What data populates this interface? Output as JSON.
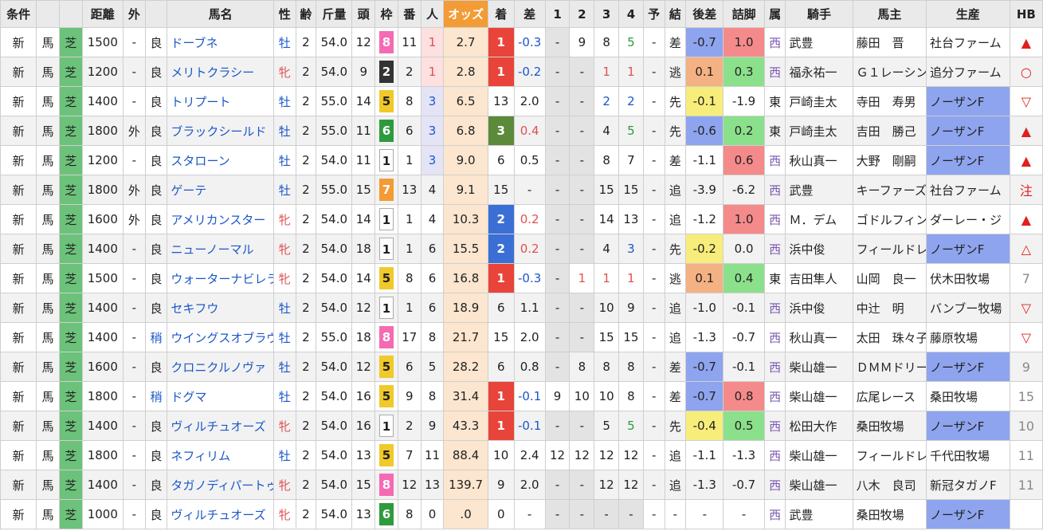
{
  "headers": [
    "条件",
    "",
    "",
    "距離",
    "外",
    "",
    "馬名",
    "性",
    "齢",
    "斤量",
    "頭",
    "枠",
    "番",
    "人",
    "オッズ",
    "着",
    "差",
    "1",
    "2",
    "3",
    "4",
    "予",
    "結",
    "後差",
    "詰脚",
    "属",
    "騎手",
    "馬主",
    "生産",
    "HB"
  ],
  "rows": [
    {
      "c": "新",
      "t": "馬",
      "s": "芝",
      "d": "1500",
      "out": "-",
      "g": "良",
      "name": "ドーブネ",
      "sex": "牡",
      "age": "2",
      "w": "54.0",
      "n": "12",
      "waku": "8",
      "ban": "11",
      "pop": "1",
      "odds": "2.7",
      "fin": "1",
      "diff": "-0.3",
      "p1": "-",
      "p2": "9",
      "p3": "8",
      "p4": "5",
      "yo": "-",
      "res": "差",
      "ago": "-0.7",
      "agoc": "blue",
      "tsu": "1.0",
      "tsuc": "red",
      "bel": "西",
      "jk": "武豊",
      "own": "藤田　晋",
      "prod": "社台ファーム",
      "prodc": "",
      "hb": "▲",
      "hbc": "hbr"
    },
    {
      "c": "新",
      "t": "馬",
      "s": "芝",
      "d": "1200",
      "out": "-",
      "g": "良",
      "name": "メリトクラシー",
      "sex": "牝",
      "age": "2",
      "w": "54.0",
      "n": "9",
      "waku": "2",
      "ban": "2",
      "pop": "1",
      "odds": "2.8",
      "fin": "1",
      "diff": "-0.2",
      "p1": "-",
      "p2": "-",
      "p3": "1",
      "p4": "1",
      "yo": "-",
      "res": "逃",
      "ago": "0.1",
      "agoc": "orange",
      "tsu": "0.3",
      "tsuc": "green",
      "bel": "西",
      "jk": "福永祐一",
      "own": "Ｇ１レーシン",
      "prod": "追分ファーム",
      "prodc": "",
      "hb": "○",
      "hbc": "hbr"
    },
    {
      "c": "新",
      "t": "馬",
      "s": "芝",
      "d": "1400",
      "out": "-",
      "g": "良",
      "name": "トリプート",
      "sex": "牡",
      "age": "2",
      "w": "55.0",
      "n": "14",
      "waku": "5",
      "ban": "8",
      "pop": "3",
      "odds": "6.5",
      "fin": "13",
      "diff": "2.0",
      "p1": "-",
      "p2": "-",
      "p3": "2",
      "p4": "2",
      "yo": "-",
      "res": "先",
      "ago": "-0.1",
      "agoc": "yellow",
      "tsu": "-1.9",
      "tsuc": "",
      "bel": "東",
      "jk": "戸崎圭太",
      "own": "寺田　寿男",
      "prod": "ノーザンF",
      "prodc": "pf",
      "hb": "▽",
      "hbc": "hbr"
    },
    {
      "c": "新",
      "t": "馬",
      "s": "芝",
      "d": "1800",
      "out": "外",
      "g": "良",
      "name": "ブラックシールド",
      "sex": "牡",
      "age": "2",
      "w": "55.0",
      "n": "11",
      "waku": "6",
      "ban": "6",
      "pop": "3",
      "odds": "6.8",
      "fin": "3",
      "diff": "0.4",
      "p1": "-",
      "p2": "-",
      "p3": "4",
      "p4": "5",
      "yo": "-",
      "res": "先",
      "ago": "-0.6",
      "agoc": "blue",
      "tsu": "0.2",
      "tsuc": "green",
      "bel": "東",
      "jk": "戸崎圭太",
      "own": "吉田　勝己",
      "prod": "ノーザンF",
      "prodc": "pf",
      "hb": "▲",
      "hbc": "hbr"
    },
    {
      "c": "新",
      "t": "馬",
      "s": "芝",
      "d": "1200",
      "out": "-",
      "g": "良",
      "name": "スタローン",
      "sex": "牡",
      "age": "2",
      "w": "54.0",
      "n": "11",
      "waku": "1",
      "ban": "1",
      "pop": "3",
      "odds": "9.0",
      "fin": "6",
      "diff": "0.5",
      "p1": "-",
      "p2": "-",
      "p3": "8",
      "p4": "7",
      "yo": "-",
      "res": "差",
      "ago": "-1.1",
      "agoc": "",
      "tsu": "0.6",
      "tsuc": "red",
      "bel": "西",
      "jk": "秋山真一",
      "own": "大野　剛嗣",
      "prod": "ノーザンF",
      "prodc": "pf",
      "hb": "▲",
      "hbc": "hbr"
    },
    {
      "c": "新",
      "t": "馬",
      "s": "芝",
      "d": "1800",
      "out": "外",
      "g": "良",
      "name": "ゲーテ",
      "sex": "牡",
      "age": "2",
      "w": "55.0",
      "n": "15",
      "waku": "7",
      "ban": "13",
      "pop": "4",
      "odds": "9.1",
      "fin": "15",
      "diff": "-",
      "p1": "-",
      "p2": "-",
      "p3": "15",
      "p4": "15",
      "yo": "-",
      "res": "追",
      "ago": "-3.9",
      "agoc": "",
      "tsu": "-6.2",
      "tsuc": "",
      "bel": "西",
      "jk": "武豊",
      "own": "キーファーズ",
      "prod": "社台ファーム",
      "prodc": "",
      "hb": "注",
      "hbc": "hbr"
    },
    {
      "c": "新",
      "t": "馬",
      "s": "芝",
      "d": "1600",
      "out": "外",
      "g": "良",
      "name": "アメリカンスター",
      "sex": "牝",
      "age": "2",
      "w": "54.0",
      "n": "14",
      "waku": "1",
      "ban": "1",
      "pop": "4",
      "odds": "10.3",
      "fin": "2",
      "diff": "0.2",
      "p1": "-",
      "p2": "-",
      "p3": "14",
      "p4": "13",
      "yo": "-",
      "res": "追",
      "ago": "-1.2",
      "agoc": "",
      "tsu": "1.0",
      "tsuc": "red",
      "bel": "西",
      "jk": "Ｍ．デム",
      "own": "ゴドルフィン",
      "prod": "ダーレー・ジ",
      "prodc": "",
      "hb": "▲",
      "hbc": "hbr"
    },
    {
      "c": "新",
      "t": "馬",
      "s": "芝",
      "d": "1400",
      "out": "-",
      "g": "良",
      "name": "ニューノーマル",
      "sex": "牝",
      "age": "2",
      "w": "54.0",
      "n": "18",
      "waku": "1",
      "ban": "1",
      "pop": "6",
      "odds": "15.5",
      "fin": "2",
      "diff": "0.2",
      "p1": "-",
      "p2": "-",
      "p3": "4",
      "p4": "3",
      "yo": "-",
      "res": "先",
      "ago": "-0.2",
      "agoc": "yellow",
      "tsu": "0.0",
      "tsuc": "",
      "bel": "西",
      "jk": "浜中俊",
      "own": "フィールドレ",
      "prod": "ノーザンF",
      "prodc": "pf",
      "hb": "△",
      "hbc": "hbr"
    },
    {
      "c": "新",
      "t": "馬",
      "s": "芝",
      "d": "1500",
      "out": "-",
      "g": "良",
      "name": "ウォーターナビレラ",
      "sex": "牝",
      "age": "2",
      "w": "54.0",
      "n": "14",
      "waku": "5",
      "ban": "8",
      "pop": "6",
      "odds": "16.8",
      "fin": "1",
      "diff": "-0.3",
      "p1": "-",
      "p2": "1",
      "p3": "1",
      "p4": "1",
      "yo": "-",
      "res": "逃",
      "ago": "0.1",
      "agoc": "orange",
      "tsu": "0.4",
      "tsuc": "green",
      "bel": "東",
      "jk": "吉田隼人",
      "own": "山岡　良一",
      "prod": "伏木田牧場",
      "prodc": "",
      "hb": "7",
      "hbc": "hbn"
    },
    {
      "c": "新",
      "t": "馬",
      "s": "芝",
      "d": "1400",
      "out": "-",
      "g": "良",
      "name": "セキフウ",
      "sex": "牡",
      "age": "2",
      "w": "54.0",
      "n": "12",
      "waku": "1",
      "ban": "1",
      "pop": "6",
      "odds": "18.9",
      "fin": "6",
      "diff": "1.1",
      "p1": "-",
      "p2": "-",
      "p3": "10",
      "p4": "9",
      "yo": "-",
      "res": "追",
      "ago": "-1.0",
      "agoc": "",
      "tsu": "-0.1",
      "tsuc": "",
      "bel": "西",
      "jk": "浜中俊",
      "own": "中辻　明",
      "prod": "バンブー牧場",
      "prodc": "",
      "hb": "▽",
      "hbc": "hbr"
    },
    {
      "c": "新",
      "t": "馬",
      "s": "芝",
      "d": "1400",
      "out": "-",
      "g": "稍",
      "name": "ウイングスオブラヴ",
      "sex": "牡",
      "age": "2",
      "w": "55.0",
      "n": "18",
      "waku": "8",
      "ban": "17",
      "pop": "8",
      "odds": "21.7",
      "fin": "15",
      "diff": "2.0",
      "p1": "-",
      "p2": "-",
      "p3": "15",
      "p4": "15",
      "yo": "-",
      "res": "追",
      "ago": "-1.3",
      "agoc": "",
      "tsu": "-0.7",
      "tsuc": "",
      "bel": "西",
      "jk": "秋山真一",
      "own": "太田　珠々子",
      "prod": "藤原牧場",
      "prodc": "",
      "hb": "▽",
      "hbc": "hbr"
    },
    {
      "c": "新",
      "t": "馬",
      "s": "芝",
      "d": "1600",
      "out": "-",
      "g": "良",
      "name": "クロニクルノヴァ",
      "sex": "牡",
      "age": "2",
      "w": "54.0",
      "n": "12",
      "waku": "5",
      "ban": "6",
      "pop": "5",
      "odds": "28.2",
      "fin": "6",
      "diff": "0.8",
      "p1": "-",
      "p2": "8",
      "p3": "8",
      "p4": "8",
      "yo": "-",
      "res": "差",
      "ago": "-0.7",
      "agoc": "blue",
      "tsu": "-0.1",
      "tsuc": "",
      "bel": "西",
      "jk": "柴山雄一",
      "own": "ＤＭＭドリー",
      "prod": "ノーザンF",
      "prodc": "pf",
      "hb": "9",
      "hbc": "hbn"
    },
    {
      "c": "新",
      "t": "馬",
      "s": "芝",
      "d": "1800",
      "out": "-",
      "g": "稍",
      "name": "ドグマ",
      "sex": "牡",
      "age": "2",
      "w": "54.0",
      "n": "16",
      "waku": "5",
      "ban": "9",
      "pop": "8",
      "odds": "31.4",
      "fin": "1",
      "diff": "-0.1",
      "p1": "9",
      "p2": "10",
      "p3": "10",
      "p4": "8",
      "yo": "-",
      "res": "差",
      "ago": "-0.7",
      "agoc": "blue",
      "tsu": "0.8",
      "tsuc": "red",
      "bel": "西",
      "jk": "柴山雄一",
      "own": "広尾レース",
      "prod": "桑田牧場",
      "prodc": "",
      "hb": "15",
      "hbc": "hbn"
    },
    {
      "c": "新",
      "t": "馬",
      "s": "芝",
      "d": "1400",
      "out": "-",
      "g": "良",
      "name": "ヴィルチュオーズ",
      "sex": "牝",
      "age": "2",
      "w": "54.0",
      "n": "16",
      "waku": "1",
      "ban": "2",
      "pop": "9",
      "odds": "43.3",
      "fin": "1",
      "diff": "-0.1",
      "p1": "-",
      "p2": "-",
      "p3": "5",
      "p4": "5",
      "yo": "-",
      "res": "先",
      "ago": "-0.4",
      "agoc": "yellow",
      "tsu": "0.5",
      "tsuc": "green",
      "bel": "西",
      "jk": "松田大作",
      "own": "桑田牧場",
      "prod": "ノーザンF",
      "prodc": "pf",
      "hb": "10",
      "hbc": "hbn"
    },
    {
      "c": "新",
      "t": "馬",
      "s": "芝",
      "d": "1800",
      "out": "-",
      "g": "良",
      "name": "ネフィリム",
      "sex": "牡",
      "age": "2",
      "w": "54.0",
      "n": "13",
      "waku": "5",
      "ban": "7",
      "pop": "11",
      "odds": "88.4",
      "fin": "10",
      "diff": "2.4",
      "p1": "12",
      "p2": "12",
      "p3": "12",
      "p4": "12",
      "yo": "-",
      "res": "追",
      "ago": "-1.1",
      "agoc": "",
      "tsu": "-1.3",
      "tsuc": "",
      "bel": "西",
      "jk": "柴山雄一",
      "own": "フィールドレ",
      "prod": "千代田牧場",
      "prodc": "",
      "hb": "11",
      "hbc": "hbn"
    },
    {
      "c": "新",
      "t": "馬",
      "s": "芝",
      "d": "1400",
      "out": "-",
      "g": "良",
      "name": "タガノディパートゥ",
      "sex": "牝",
      "age": "2",
      "w": "54.0",
      "n": "15",
      "waku": "8",
      "ban": "12",
      "pop": "13",
      "odds": "139.7",
      "fin": "9",
      "diff": "2.0",
      "p1": "-",
      "p2": "-",
      "p3": "12",
      "p4": "12",
      "yo": "-",
      "res": "追",
      "ago": "-1.3",
      "agoc": "",
      "tsu": "-0.7",
      "tsuc": "",
      "bel": "西",
      "jk": "柴山雄一",
      "own": "八木　良司",
      "prod": "新冠タガノF",
      "prodc": "",
      "hb": "11",
      "hbc": "hbn"
    },
    {
      "c": "新",
      "t": "馬",
      "s": "芝",
      "d": "1000",
      "out": "-",
      "g": "良",
      "name": "ヴィルチュオーズ",
      "sex": "牝",
      "age": "2",
      "w": "54.0",
      "n": "13",
      "waku": "6",
      "ban": "8",
      "pop": "0",
      "odds": ".0",
      "fin": "0",
      "diff": "-",
      "p1": "-",
      "p2": "-",
      "p3": "-",
      "p4": "-",
      "yo": "-",
      "res": "-",
      "ago": "-",
      "agoc": "",
      "tsu": "-",
      "tsuc": "",
      "bel": "西",
      "jk": "武豊",
      "own": "桑田牧場",
      "prod": "ノーザンF",
      "prodc": "pf",
      "hb": "",
      "hbc": "hbn"
    }
  ]
}
